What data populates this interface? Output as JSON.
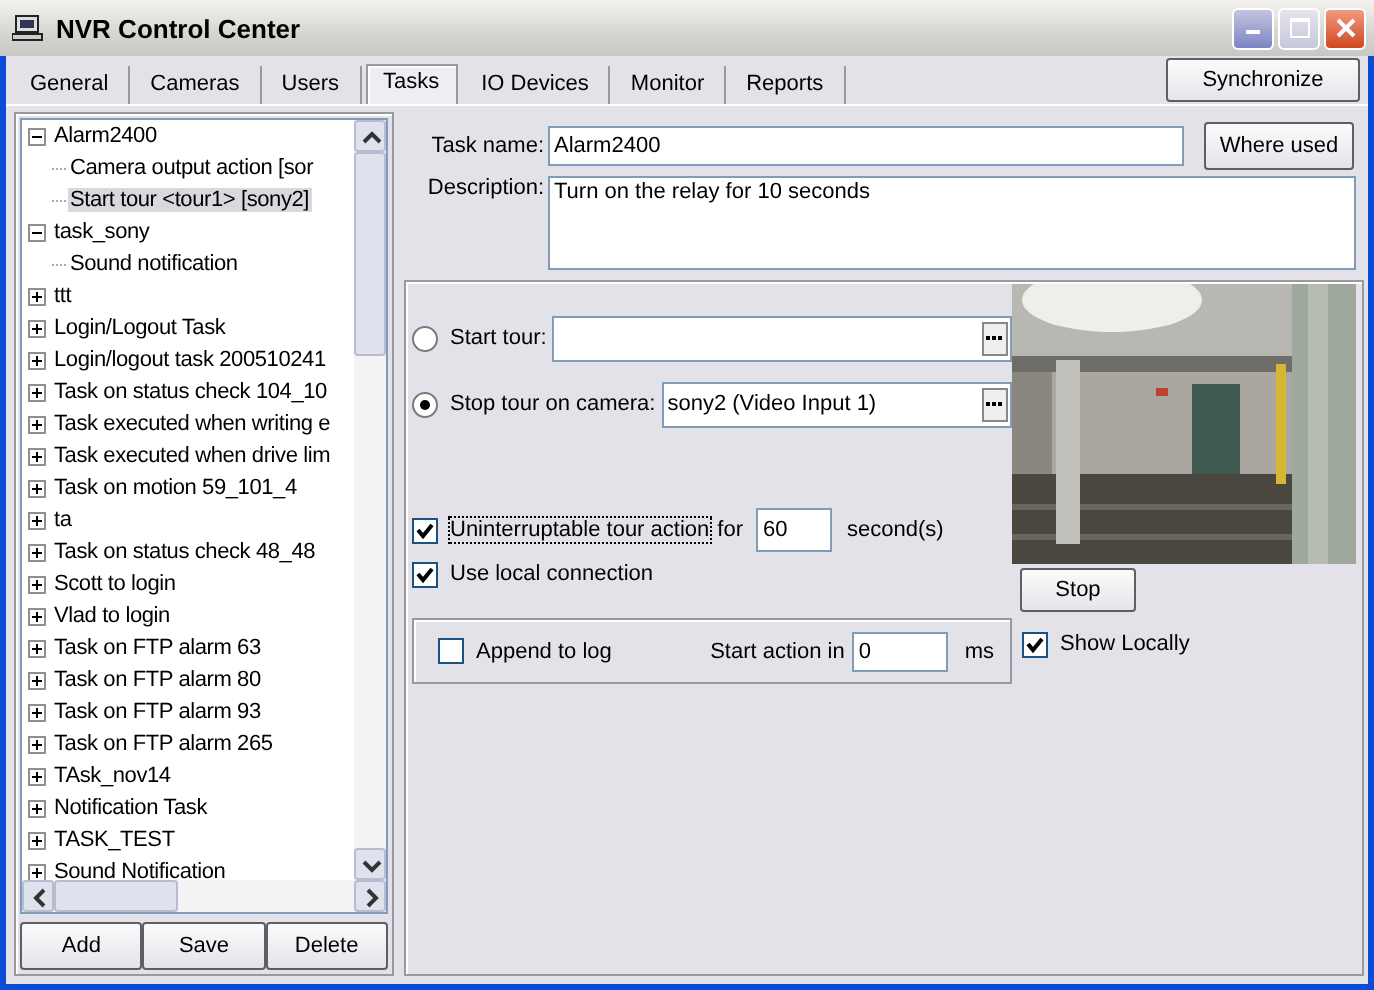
{
  "window": {
    "title": "NVR Control Center"
  },
  "tabs": [
    {
      "label": "General",
      "selected": false
    },
    {
      "label": "Cameras",
      "selected": false
    },
    {
      "label": "Users",
      "selected": false
    },
    {
      "label": "Tasks",
      "selected": true
    },
    {
      "label": "IO Devices",
      "selected": false
    },
    {
      "label": "Monitor",
      "selected": false
    },
    {
      "label": "Reports",
      "selected": false
    }
  ],
  "sync_button": "Synchronize",
  "tree": [
    {
      "label": "Alarm2400",
      "expanded": true,
      "selected": false,
      "children": [
        {
          "label": "Camera output action [sor",
          "selected": false
        },
        {
          "label": "Start tour <tour1> [sony2]",
          "selected": true
        }
      ]
    },
    {
      "label": "task_sony",
      "expanded": true,
      "selected": false,
      "children": [
        {
          "label": "Sound notification",
          "selected": false
        }
      ]
    },
    {
      "label": "ttt",
      "expanded": false,
      "selected": false
    },
    {
      "label": "Login/Logout Task",
      "expanded": false,
      "selected": false
    },
    {
      "label": "Login/logout task 200510241",
      "expanded": false,
      "selected": false
    },
    {
      "label": "Task on status check 104_10",
      "expanded": false,
      "selected": false
    },
    {
      "label": "Task executed when writing e",
      "expanded": false,
      "selected": false
    },
    {
      "label": "Task executed when drive lim",
      "expanded": false,
      "selected": false
    },
    {
      "label": "Task on motion 59_101_4",
      "expanded": false,
      "selected": false
    },
    {
      "label": "ta",
      "expanded": false,
      "selected": false
    },
    {
      "label": "Task on status check 48_48",
      "expanded": false,
      "selected": false
    },
    {
      "label": "Scott to login",
      "expanded": false,
      "selected": false
    },
    {
      "label": "Vlad to login",
      "expanded": false,
      "selected": false
    },
    {
      "label": "Task on FTP alarm 63",
      "expanded": false,
      "selected": false
    },
    {
      "label": "Task on FTP alarm 80",
      "expanded": false,
      "selected": false
    },
    {
      "label": "Task on FTP alarm 93",
      "expanded": false,
      "selected": false
    },
    {
      "label": "Task on FTP alarm 265",
      "expanded": false,
      "selected": false
    },
    {
      "label": "TAsk_nov14",
      "expanded": false,
      "selected": false
    },
    {
      "label": "Notification Task",
      "expanded": false,
      "selected": false
    },
    {
      "label": "TASK_TEST",
      "expanded": false,
      "selected": false
    },
    {
      "label": "Sound Notification",
      "expanded": false,
      "selected": false
    }
  ],
  "tree_buttons": [
    "Add",
    "Save",
    "Delete"
  ],
  "task": {
    "name_label": "Task name:",
    "name": "Alarm2400",
    "where_used": "Where used",
    "description_label": "Description:",
    "description": "Turn on the relay for 10 seconds"
  },
  "tour_options": [
    {
      "label": "Start tour:",
      "selected": false
    },
    {
      "label": "Stop tour on camera:",
      "selected": true,
      "value": "sony2 (Video Input 1)"
    }
  ],
  "uninterruptable": {
    "label": "Uninterruptable tour action",
    "checked": true,
    "for": "for",
    "value": "60",
    "unit": "second(s)"
  },
  "local_connection": {
    "label": "Use local connection",
    "checked": true
  },
  "append_log": {
    "label": "Append to log",
    "checked": false
  },
  "start_action": {
    "label": "Start action in",
    "value": "0",
    "unit": "ms"
  },
  "preview": {
    "stop_button": "Stop",
    "show_locally": {
      "label": "Show Locally",
      "checked": true
    }
  }
}
